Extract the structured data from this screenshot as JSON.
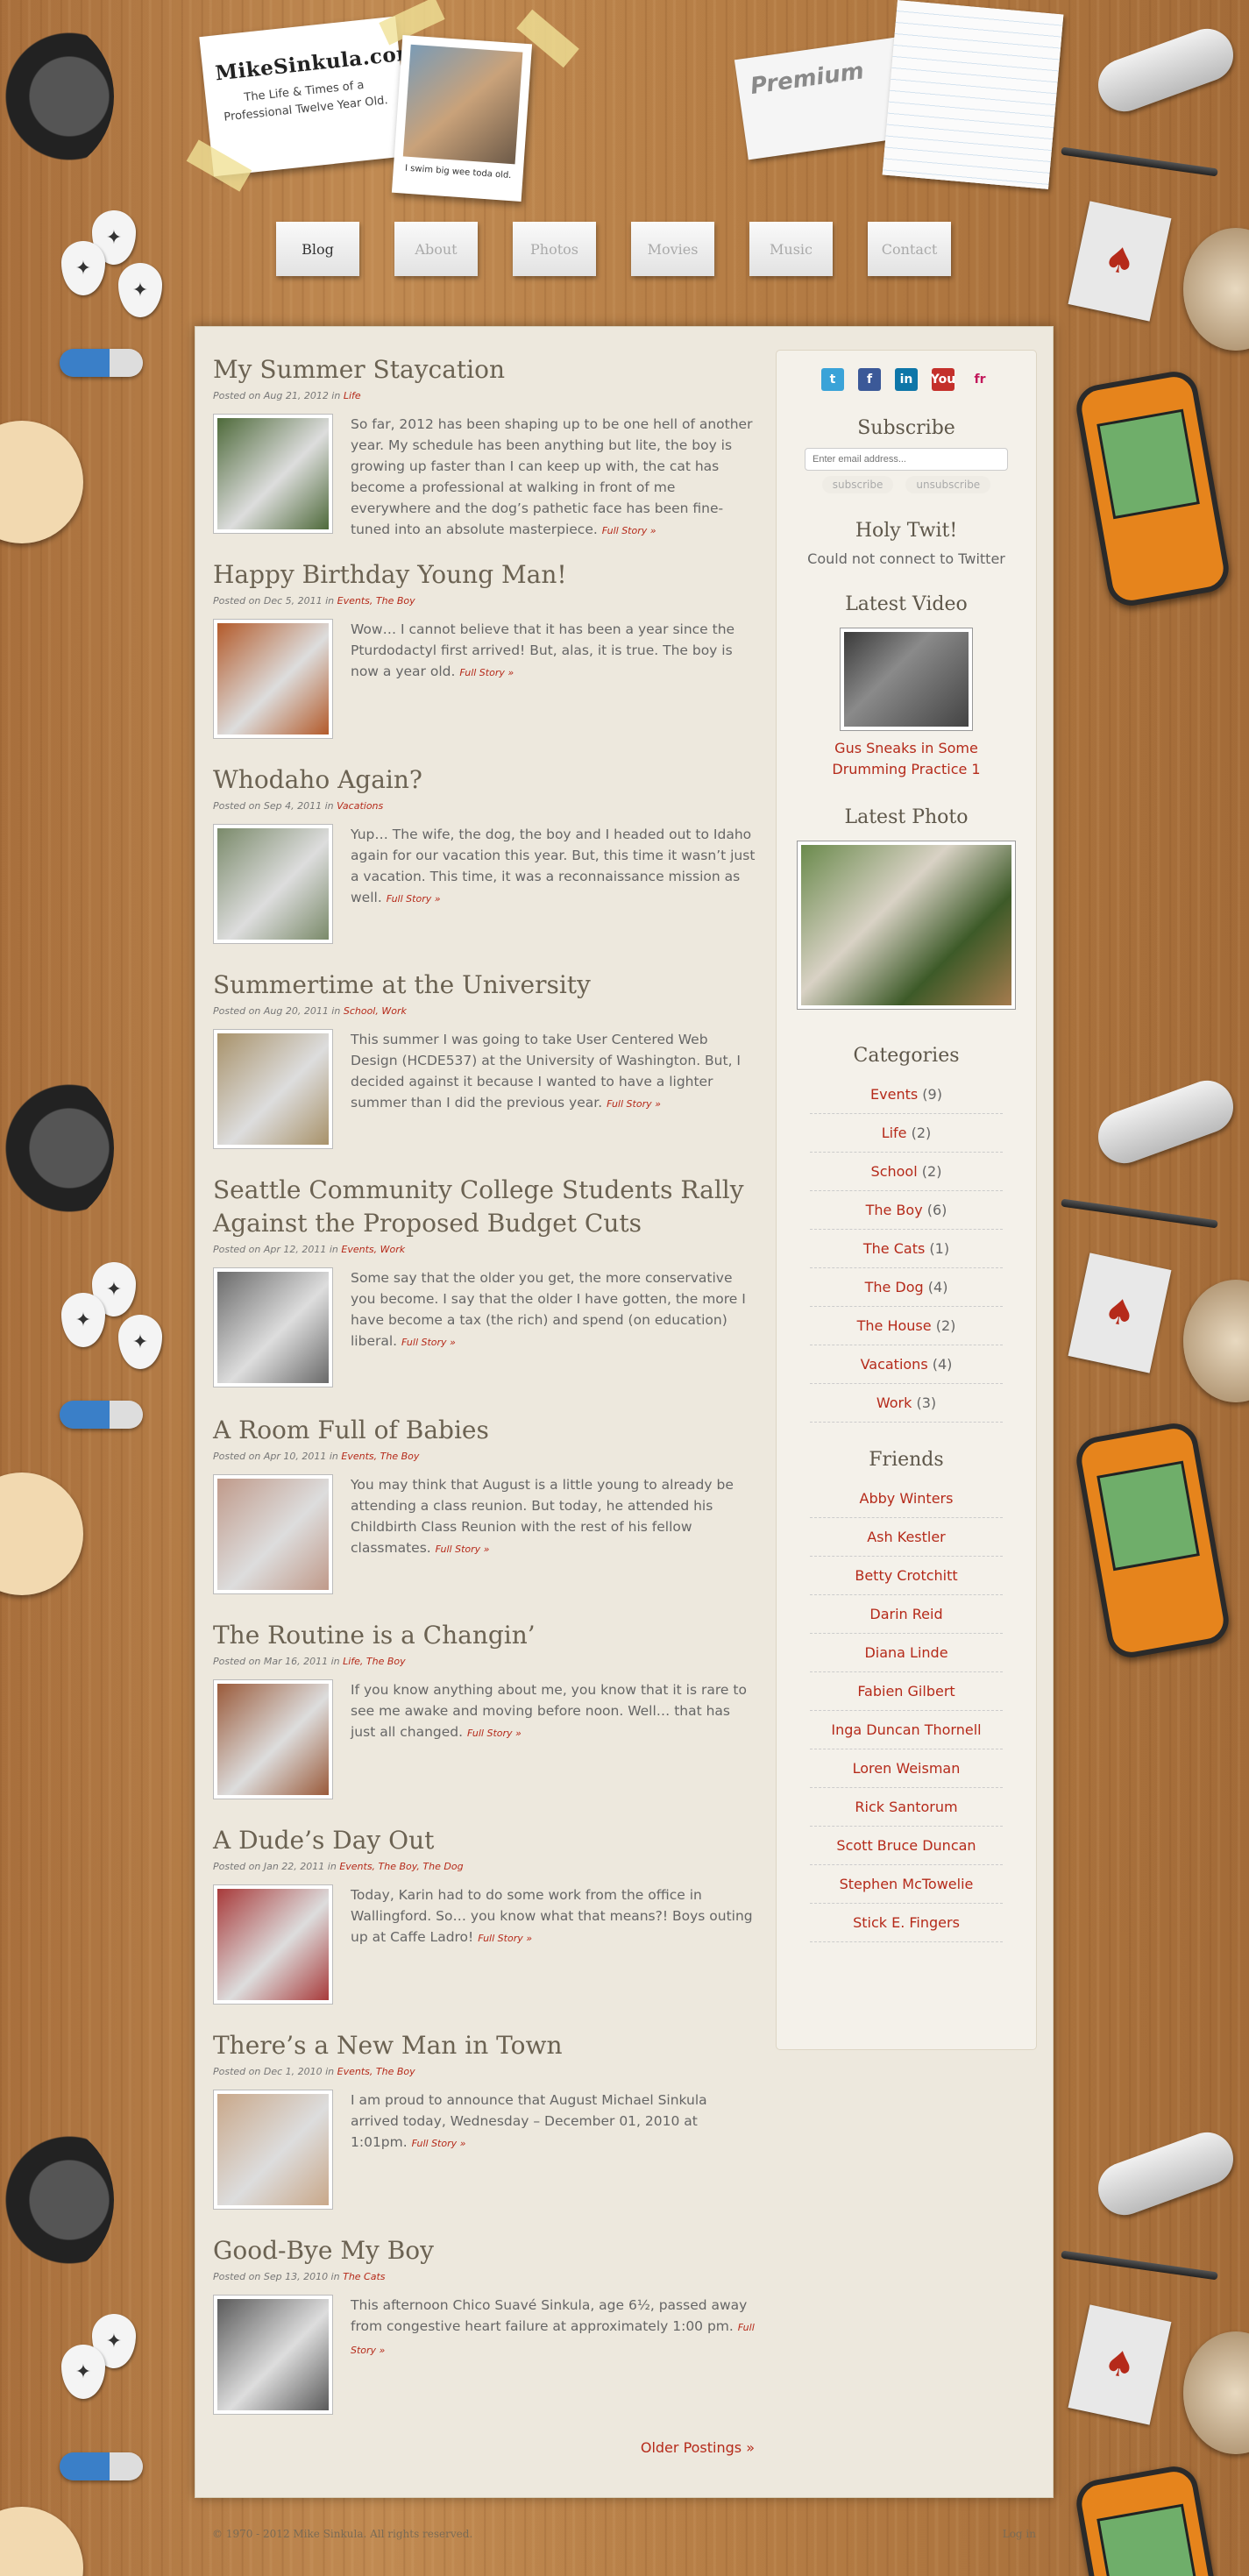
{
  "header": {
    "site_title": "MikeSinkula.com",
    "site_subtitle": "The Life & Times of a Professional Twelve Year Old.",
    "polaroid_caption": "I swim big wee toda old.",
    "card_brand": "Premium"
  },
  "nav": [
    {
      "label": "Blog"
    },
    {
      "label": "About"
    },
    {
      "label": "Photos"
    },
    {
      "label": "Movies"
    },
    {
      "label": "Music"
    },
    {
      "label": "Contact"
    }
  ],
  "posts": [
    {
      "title": "My Summer Staycation",
      "meta_prefix": "Posted on Aug 21, 2012 in ",
      "categories": "Life",
      "excerpt": "So far, 2012 has been shaping up to be one hell of another year. My schedule has been anything but lite, the boy is growing up faster than I can keep up with, the cat has become a professional at walking in front of me everywhere and the dog’s pathetic face has been fine-tuned into an absolute masterpiece.",
      "more": "Full Story »",
      "color": "#4e6a3a"
    },
    {
      "title": "Happy Birthday Young Man!",
      "meta_prefix": "Posted on Dec 5, 2011 in ",
      "categories": "Events, The Boy",
      "excerpt": "Wow… I cannot believe that it has been a year since the Pturdodactyl first arrived! But, alas, it is true. The boy is now a year old.",
      "more": "Full Story »",
      "color": "#b35a2a"
    },
    {
      "title": "Whodaho Again?",
      "meta_prefix": "Posted on Sep 4, 2011 in ",
      "categories": "Vacations",
      "excerpt": "Yup… The wife, the dog, the boy and I headed out to Idaho again for our vacation this year. But, this time it wasn’t just a vacation. This time, it was a reconnaissance mission as well.",
      "more": "Full Story »",
      "color": "#7a8a6a"
    },
    {
      "title": "Summertime at the University",
      "meta_prefix": "Posted on Aug 20, 2011 in ",
      "categories": "School, Work",
      "excerpt": "This summer I was going to take User Centered Web Design (HCDE537) at the University of Washington. But, I decided against it because I wanted to have a lighter summer than I did the previous year.",
      "more": "Full Story »",
      "color": "#a8926a"
    },
    {
      "title": "Seattle Community College Students Rally Against the Proposed Budget Cuts",
      "meta_prefix": "Posted on Apr 12, 2011 in ",
      "categories": "Events, Work",
      "excerpt": "Some say that the older you get, the more conservative you become. I say that the older I have gotten, the more I have become a tax (the rich) and spend (on education) liberal.",
      "more": "Full Story »",
      "color": "#6a6a6a"
    },
    {
      "title": "A Room Full of Babies",
      "meta_prefix": "Posted on Apr 10, 2011 in ",
      "categories": "Events, The Boy",
      "excerpt": "You may think that August is a little young to already be attending a class reunion. But today, he attended his Childbirth Class Reunion with the rest of his fellow classmates.",
      "more": "Full Story »",
      "color": "#c09a8a"
    },
    {
      "title": "The Routine is a Changin’",
      "meta_prefix": "Posted on Mar 16, 2011 in ",
      "categories": "Life, The Boy",
      "excerpt": "If you know anything about me, you know that it is rare to see me awake and moving before noon. Well… that has just all changed.",
      "more": "Full Story »",
      "color": "#9a5a3a"
    },
    {
      "title": "A Dude’s Day Out",
      "meta_prefix": "Posted on Jan 22, 2011 in ",
      "categories": "Events, The Boy, The Dog",
      "excerpt": "Today, Karin had to do some work from the office in Wallingford. So… you know what that means?! Boys outing up at Caffe Ladro!",
      "more": "Full Story »",
      "color": "#a83a3a"
    },
    {
      "title": "There’s a New Man in Town",
      "meta_prefix": "Posted on Dec 1, 2010 in ",
      "categories": "Events, The Boy",
      "excerpt": "I am proud to announce that August Michael Sinkula arrived today, Wednesday – December 01, 2010 at 1:01pm.",
      "more": "Full Story »",
      "color": "#c9a88a"
    },
    {
      "title": "Good-Bye My Boy",
      "meta_prefix": "Posted on Sep 13, 2010 in ",
      "categories": "The Cats",
      "excerpt": "This afternoon Chico Suavé Sinkula, age 6½, passed away from congestive heart failure at approximately 1:00 pm.",
      "more": "Full Story »",
      "color": "#5a5a5a"
    }
  ],
  "older": "Older Postings »",
  "sidebar": {
    "social": [
      {
        "icon": "t",
        "name": "twitter-icon",
        "color": "#3aa3d8"
      },
      {
        "icon": "f",
        "name": "facebook-icon",
        "color": "#3b5998"
      },
      {
        "icon": "in",
        "name": "linkedin-icon",
        "color": "#0e76a8"
      },
      {
        "icon": "You",
        "name": "youtube-icon",
        "color": "#c4302b"
      },
      {
        "icon": "fr",
        "name": "friendfeed-icon",
        "color": "#f4f1ea"
      }
    ],
    "subscribe_title": "Subscribe",
    "email_placeholder": "Enter email address...",
    "subscribe_btn": "subscribe",
    "unsubscribe_btn": "unsubscribe",
    "twit_title": "Holy Twit!",
    "twit_text": "Could not connect to Twitter",
    "video_title": "Latest Video",
    "video_caption": "Gus Sneaks in Some Drumming Practice 1",
    "photo_title": "Latest Photo",
    "categories_title": "Categories",
    "categories": [
      {
        "name": "Events",
        "count": "(9)"
      },
      {
        "name": "Life",
        "count": "(2)"
      },
      {
        "name": "School",
        "count": "(2)"
      },
      {
        "name": "The Boy",
        "count": "(6)"
      },
      {
        "name": "The Cats",
        "count": "(1)"
      },
      {
        "name": "The Dog",
        "count": "(4)"
      },
      {
        "name": "The House",
        "count": "(2)"
      },
      {
        "name": "Vacations",
        "count": "(4)"
      },
      {
        "name": "Work",
        "count": "(3)"
      }
    ],
    "friends_title": "Friends",
    "friends": [
      "Abby Winters",
      "Ash Kestler",
      "Betty Crotchitt",
      "Darin Reid",
      "Diana Linde",
      "Fabien Gilbert",
      "Inga Duncan Thornell",
      "Loren Weisman",
      "Rick Santorum",
      "Scott Bruce Duncan",
      "Stephen McTowelie",
      "Stick E. Fingers"
    ]
  },
  "footer": {
    "copyright": "© 1970 - 2012 Mike Sinkula. All rights reserved.",
    "login": "Log in"
  }
}
